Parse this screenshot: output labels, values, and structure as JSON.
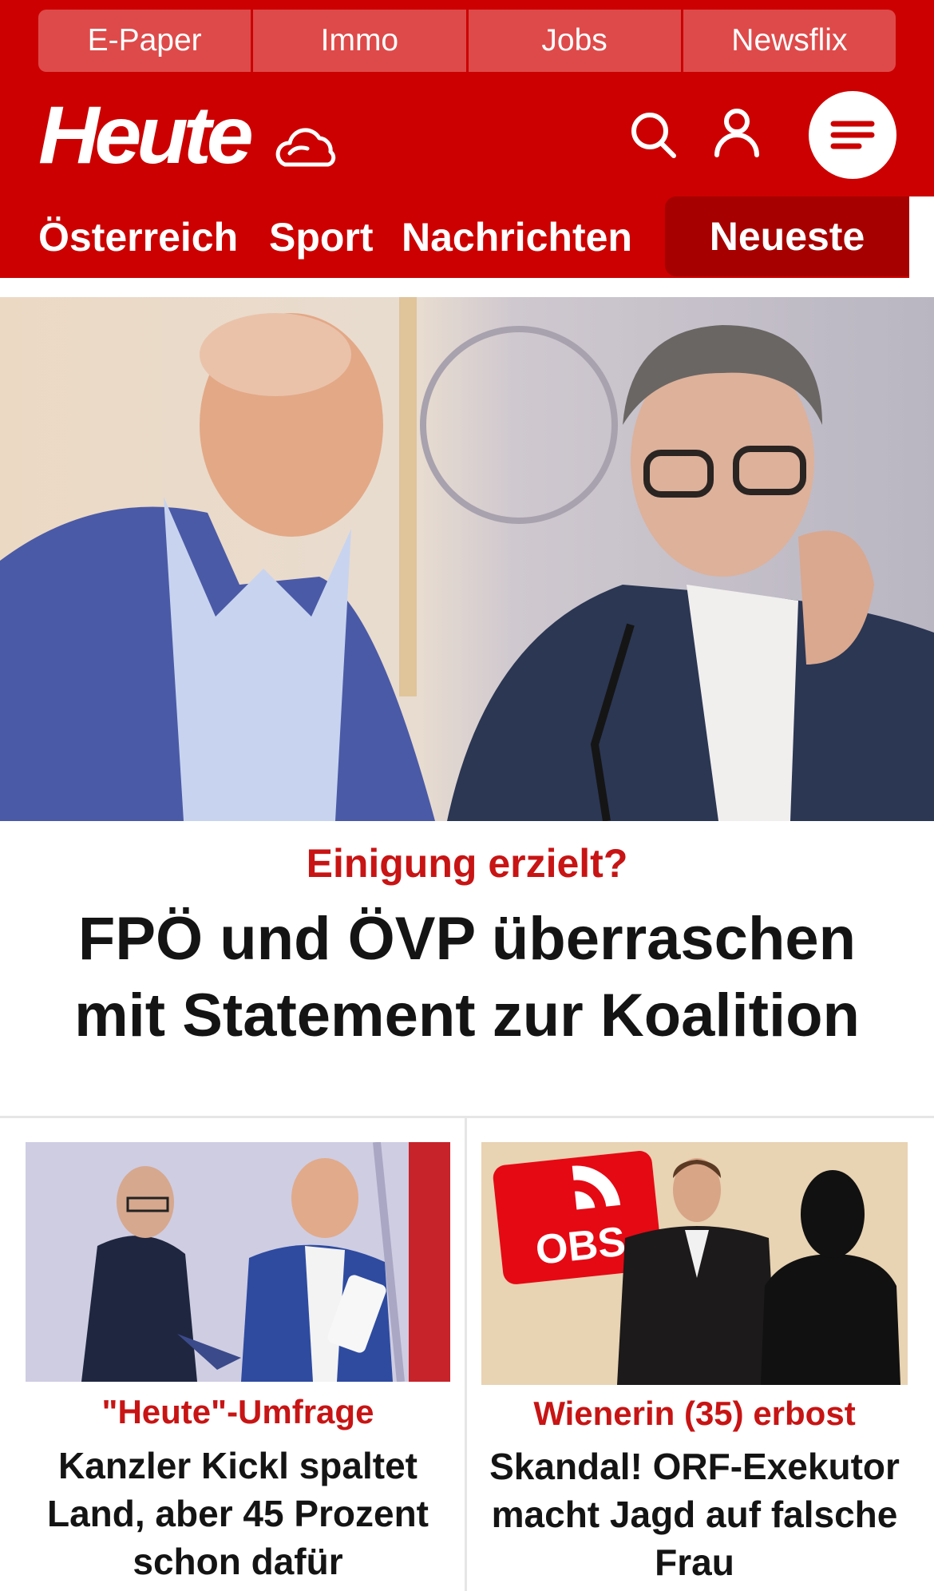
{
  "top_links": [
    "E-Paper",
    "Immo",
    "Jobs",
    "Newsflix"
  ],
  "brand": {
    "logo": "Heute",
    "weather_icon": "cloud-sun-icon"
  },
  "header_icons": {
    "search": "search-icon",
    "account": "user-icon",
    "menu": "hamburger-menu-icon"
  },
  "nav": {
    "items": [
      "Österreich",
      "Sport",
      "Nachrichten"
    ],
    "active": "Neueste"
  },
  "hero": {
    "kicker": "Einigung erzielt?",
    "title": "FPÖ und ÖVP überraschen mit Statement zur Koalition"
  },
  "teasers": [
    {
      "kicker": "\"Heute\"-Umfrage",
      "title": "Kanzler Kickl spaltet Land, aber 45 Prozent schon dafür"
    },
    {
      "kicker": "Wienerin (35) erbost",
      "title": "Skandal! ORF-Exekutor macht Jagd auf falsche Frau",
      "image_badge": "OBS"
    }
  ],
  "colors": {
    "brand_red": "#cc0000",
    "active_tab": "#a60000",
    "kicker_red": "#c81414",
    "text": "#141414"
  }
}
